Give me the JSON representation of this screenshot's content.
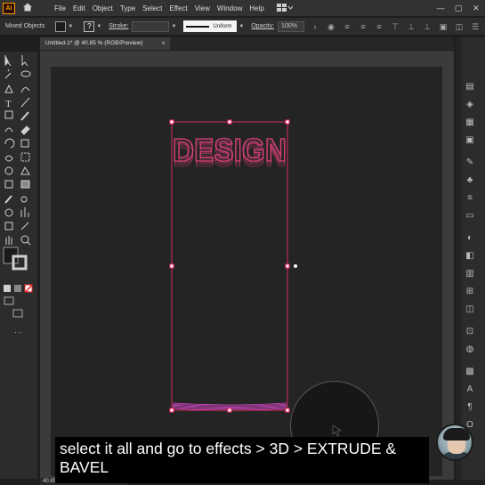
{
  "app": {
    "logo_text": "Ai",
    "menu": [
      "File",
      "Edit",
      "Object",
      "Type",
      "Select",
      "Effect",
      "View",
      "Window",
      "Help"
    ],
    "window_controls": [
      "—",
      "▢",
      "✕"
    ]
  },
  "control_bar": {
    "selection_label": "Mixed Objects",
    "stroke_label": "Stroke:",
    "stroke_value": "",
    "profile_label": "Uniform",
    "opacity_label": "Opacity:",
    "opacity_value": "100%"
  },
  "document": {
    "tab_title": "Untitled-1* @ 40.85 % (RGB/Preview)",
    "tab_close": "×",
    "zoom_status": "40.85"
  },
  "artwork": {
    "text": "DESIGN",
    "colors": {
      "top": "#b33a68",
      "mid": "#ff3f72",
      "bottom": "#d848c8",
      "selection": "#ff2d6e"
    }
  },
  "subtitle": {
    "text": "select it all and go to effects > 3D > EXTRUDE & BAVEL"
  },
  "colors": {
    "menubar": "#323232",
    "panel": "#2c2c2c",
    "canvas": "#3b3b3b",
    "artboard": "#242424"
  },
  "icons": {
    "toolbar": [
      "selection-tool-icon",
      "direct-selection-tool-icon",
      "magic-wand-icon",
      "lasso-icon",
      "pen-tool-icon",
      "curvature-icon",
      "type-tool-icon",
      "line-tool-icon",
      "rectangle-tool-icon",
      "paintbrush-icon",
      "shaper-icon",
      "eraser-icon",
      "rotate-icon",
      "scale-icon",
      "width-icon",
      "free-transform-icon",
      "shape-builder-icon",
      "perspective-icon",
      "mesh-icon",
      "gradient-icon",
      "eyedropper-icon",
      "blend-icon",
      "symbol-sprayer-icon",
      "graph-icon",
      "artboard-tool-icon",
      "slice-icon",
      "hand-tool-icon",
      "zoom-tool-icon"
    ],
    "right_panel": [
      "properties-icon",
      "layers-icon",
      "libraries-icon",
      "swatches-icon",
      "brushes-icon",
      "symbols-icon",
      "stroke-icon",
      "gradient-panel-icon",
      "transparency-icon",
      "appearance-icon",
      "graphic-styles-icon",
      "align-icon",
      "pathfinder-icon",
      "transform-icon",
      "color-icon",
      "color-guide-icon",
      "character-icon",
      "paragraph-icon",
      "opentype-icon"
    ]
  }
}
